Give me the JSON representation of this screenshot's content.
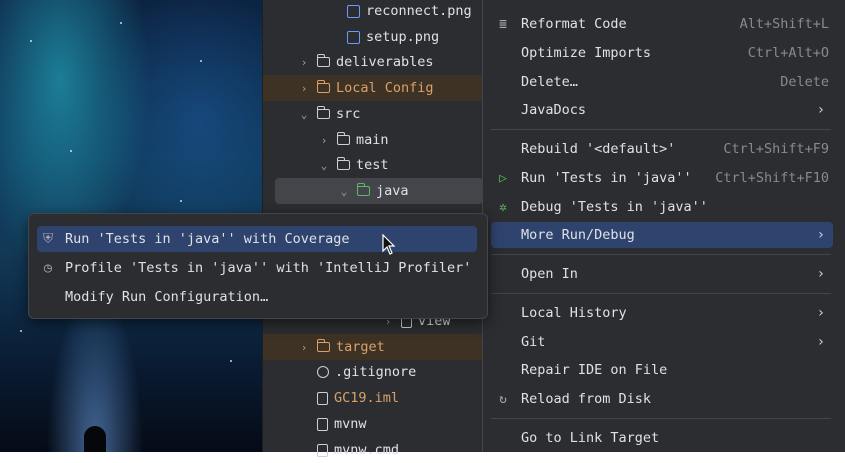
{
  "tree": {
    "items": [
      {
        "label": "reconnect.png",
        "icon": "image-file-icon"
      },
      {
        "label": "setup.png",
        "icon": "image-file-icon"
      },
      {
        "label": "deliverables",
        "icon": "folder-icon"
      },
      {
        "label": "Local Config",
        "icon": "folder-icon"
      },
      {
        "label": "src",
        "icon": "folder-icon"
      },
      {
        "label": "main",
        "icon": "folder-icon"
      },
      {
        "label": "test",
        "icon": "folder-icon"
      },
      {
        "label": "java",
        "icon": "test-folder-icon"
      },
      {
        "label": "view",
        "icon": "package-icon"
      },
      {
        "label": "target",
        "icon": "folder-icon"
      },
      {
        "label": ".gitignore",
        "icon": "ignore-file-icon"
      },
      {
        "label": "GC19.iml",
        "icon": "module-file-icon"
      },
      {
        "label": "mvnw",
        "icon": "script-file-icon"
      },
      {
        "label": "mvnw.cmd",
        "icon": "text-file-icon"
      }
    ]
  },
  "menu": {
    "items": [
      {
        "label": "Reformat Code",
        "shortcut": "Alt+Shift+L",
        "icon": "reformat-icon"
      },
      {
        "label": "Optimize Imports",
        "shortcut": "Ctrl+Alt+O"
      },
      {
        "label": "Delete…",
        "shortcut": "Delete"
      },
      {
        "label": "JavaDocs",
        "shortcut": ""
      },
      {
        "label": "Rebuild '<default>'",
        "shortcut": "Ctrl+Shift+F9"
      },
      {
        "label": "Run 'Tests in 'java''",
        "shortcut": "Ctrl+Shift+F10",
        "icon": "run-icon"
      },
      {
        "label": "Debug 'Tests in 'java''",
        "shortcut": "",
        "icon": "debug-icon"
      },
      {
        "label": "More Run/Debug",
        "shortcut": ""
      },
      {
        "label": "Open In",
        "shortcut": ""
      },
      {
        "label": "Local History",
        "shortcut": ""
      },
      {
        "label": "Git",
        "shortcut": ""
      },
      {
        "label": "Repair IDE on File",
        "shortcut": ""
      },
      {
        "label": "Reload from Disk",
        "shortcut": "",
        "icon": "reload-icon"
      },
      {
        "label": "Go to Link Target",
        "shortcut": ""
      }
    ]
  },
  "submenu": {
    "items": [
      {
        "label": "Run 'Tests in 'java'' with Coverage",
        "icon": "coverage-icon"
      },
      {
        "label": "Profile 'Tests in 'java'' with 'IntelliJ Profiler'",
        "icon": "profiler-icon"
      },
      {
        "label": "Modify Run Configuration…"
      }
    ]
  },
  "colors": {
    "accent": "#2e436e",
    "background": "#2b2d30",
    "test_folder": "#5fb85f",
    "excluded": "#d9a06b",
    "image_icon": "#6b9bfa"
  }
}
